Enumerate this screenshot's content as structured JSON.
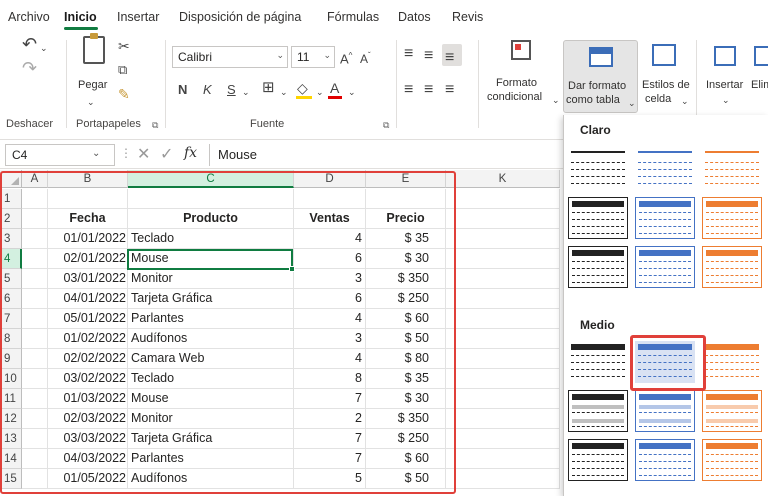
{
  "menu": {
    "tabs": [
      "Archivo",
      "Inicio",
      "Insertar",
      "Disposición de página",
      "Fórmulas",
      "Datos",
      "Revis"
    ]
  },
  "ribbon": {
    "undo_label": "Deshacer",
    "paste_label": "Pegar",
    "clipboard_label": "Portapapeles",
    "font_name": "Calibri",
    "font_size": "11",
    "font_group_label": "Fuente",
    "bold_glyph": "N",
    "italic_glyph": "K",
    "underline_glyph": "S",
    "cond_format_label_1": "Formato",
    "cond_format_label_2": "condicional",
    "format_table_label_1": "Dar formato",
    "format_table_label_2": "como tabla",
    "cell_styles_label_1": "Estilos de",
    "cell_styles_label_2": "celda",
    "insert_label": "Insertar",
    "delete_label": "Elim"
  },
  "formula_bar": {
    "name_box": "C4",
    "fx": "fx",
    "content": "Mouse"
  },
  "sheet": {
    "columns": [
      "A",
      "B",
      "C",
      "D",
      "E",
      "K"
    ],
    "row_numbers": [
      "1",
      "2",
      "3",
      "4",
      "5",
      "6",
      "7",
      "8",
      "9",
      "10",
      "11",
      "12",
      "13",
      "14",
      "15"
    ],
    "headers": {
      "fecha": "Fecha",
      "producto": "Producto",
      "ventas": "Ventas",
      "precio": "Precio"
    },
    "rows": [
      [
        "01/01/2022",
        "Teclado",
        "4",
        "$ 35"
      ],
      [
        "02/01/2022",
        "Mouse",
        "6",
        "$ 30"
      ],
      [
        "03/01/2022",
        "Monitor",
        "3",
        "$ 350"
      ],
      [
        "04/01/2022",
        "Tarjeta Gráfica",
        "6",
        "$ 250"
      ],
      [
        "05/01/2022",
        "Parlantes",
        "4",
        "$ 60"
      ],
      [
        "01/02/2022",
        "Audífonos",
        "3",
        "$ 50"
      ],
      [
        "02/02/2022",
        "Camara Web",
        "4",
        "$ 80"
      ],
      [
        "03/02/2022",
        "Teclado",
        "8",
        "$ 35"
      ],
      [
        "01/03/2022",
        "Mouse",
        "7",
        "$ 30"
      ],
      [
        "02/03/2022",
        "Monitor",
        "2",
        "$ 350"
      ],
      [
        "03/03/2022",
        "Tarjeta Gráfica",
        "7",
        "$ 250"
      ],
      [
        "04/03/2022",
        "Parlantes",
        "7",
        "$ 60"
      ],
      [
        "01/05/2022",
        "Audífonos",
        "5",
        "$ 50"
      ]
    ]
  },
  "gallery": {
    "light_label": "Claro",
    "medium_label": "Medio",
    "colors": {
      "gray": "#222222",
      "blue": "#4472c4",
      "orange": "#ed7d31"
    }
  },
  "accent": "#107c41",
  "highlight": "#e0403a"
}
